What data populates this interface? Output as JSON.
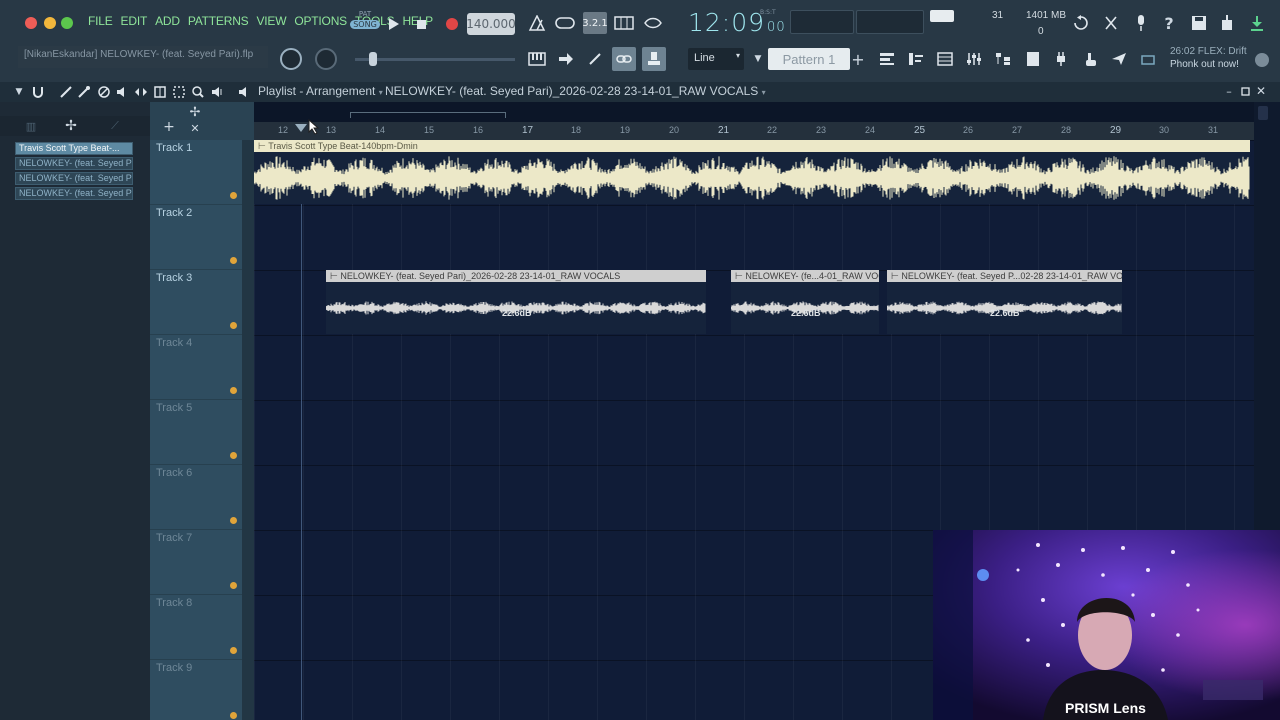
{
  "menu": [
    "FILE",
    "EDIT",
    "ADD",
    "PATTERNS",
    "VIEW",
    "OPTIONS",
    "TOOLS",
    "HELP"
  ],
  "transport": {
    "mode_pat": "PAT",
    "mode_song": "SONG",
    "tempo": "140.000",
    "time_main": "12:09",
    "time_sub": "00",
    "time_label": "B:S:T"
  },
  "status": {
    "cpu_value": "31",
    "ram_value": "1401 MB",
    "poly": "0"
  },
  "project_name": "[NikanEskandar] NELOWKEY- (feat. Seyed Pari).flp",
  "snap": "Line",
  "pattern": "Pattern 1",
  "hint": {
    "line1": "26:02  FLEX: Drift",
    "line2": "Phonk out now!"
  },
  "playlist": {
    "title_prefix": "Playlist - Arrangement",
    "title_clip": "NELOWKEY- (feat. Seyed Pari)_2026-02-28 23-14-01_RAW VOCALS"
  },
  "picker_clips": [
    "Travis Scott Type Beat-...",
    "NELOWKEY- (feat. Seyed Pari...",
    "NELOWKEY- (feat. Seyed Pari...",
    "NELOWKEY- (feat. Seyed Pari..."
  ],
  "ruler": [
    "12",
    "13",
    "14",
    "15",
    "16",
    "17",
    "18",
    "19",
    "20",
    "21",
    "22",
    "23",
    "24",
    "25",
    "26",
    "27",
    "28",
    "29",
    "30",
    "31"
  ],
  "tracks": [
    "Track 1",
    "Track 2",
    "Track 3",
    "Track 4",
    "Track 5",
    "Track 6",
    "Track 7",
    "Track 8",
    "Track 9"
  ],
  "clips": {
    "beat": {
      "label": "Travis Scott Type Beat-140bpm-Dmin"
    },
    "vocal1": {
      "label": "NELOWKEY- (feat. Seyed Pari)_2026-02-28 23-14-01_RAW VOCALS",
      "gain": "22.6dB"
    },
    "vocal2": {
      "label": "NELOWKEY- (fe...4-01_RAW VOCALS",
      "gain": "22.6dB"
    },
    "vocal3": {
      "label": "NELOWKEY- (feat. Seyed P...02-28 23-14-01_RAW VOCALS",
      "gain": "22.6dB"
    }
  },
  "webcam_label": "PRISM Lens",
  "colors": {
    "accent_green": "#8fe59a",
    "clip_beat": "#ece8c8",
    "clip_vocal": "#d9d9d9",
    "grid_bg": "#101c37",
    "record": "#e04646"
  }
}
